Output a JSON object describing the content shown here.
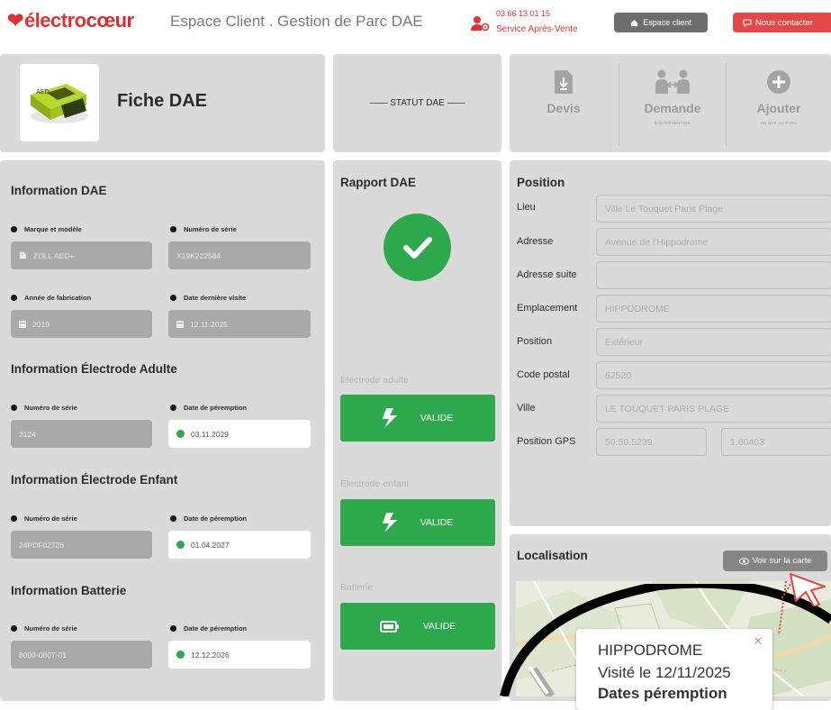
{
  "header": {
    "logo_part1": "électro",
    "logo_part2": "cœur",
    "site_title": "Espace Client . Gestion de Parc DAE",
    "phone_number": "03 66 13 01 15",
    "phone_caption": "Service Après-Vente",
    "espace_client_label": "Espace client",
    "contact_label": "Nous contacter"
  },
  "top": {
    "fiche_title": "Fiche DAE",
    "fiche_image_text": "AED",
    "statut_label": "—— STATUT DAE ——",
    "actions": [
      {
        "label": "Devis",
        "sub": "",
        "icon": "document-download-icon"
      },
      {
        "label": "Demande",
        "sub": "D'INTERVENTION",
        "icon": "technician-icon"
      },
      {
        "label": "Ajouter",
        "sub": "UN DAE AU PARC",
        "icon": "plus-circle-icon"
      }
    ]
  },
  "info_dae": {
    "title": "Information DAE",
    "marque_label": "Marque et modèle",
    "marque_value": "ZOLL AED+",
    "serie_label": "Numéro de série",
    "serie_value": "X19K222584",
    "annee_label": "Année de fabrication",
    "annee_value": "2019",
    "visite_label": "Date dernière visite",
    "visite_value": "12.11.2025"
  },
  "electrode_adulte": {
    "title": "Information Électrode Adulte",
    "serie_label": "Numéro de série",
    "serie_value": "3124",
    "peremption_label": "Date de péremption",
    "peremption_value": "03.11.2029"
  },
  "electrode_enfant": {
    "title": "Information Électrode Enfant",
    "serie_label": "Numéro de série",
    "serie_value": "24PDF02726",
    "peremption_label": "Date de péremption",
    "peremption_value": "01.04.2027"
  },
  "batterie": {
    "title": "Information Batterie",
    "serie_label": "Numéro de série",
    "serie_value": "8000-0807-01",
    "peremption_label": "Date de péremption",
    "peremption_value": "12.12.2026"
  },
  "rapport": {
    "title": "Rapport DAE",
    "items": [
      {
        "label": "Électrode adulte",
        "status": "VALIDE",
        "icon": "bolt-icon"
      },
      {
        "label": "Électrode enfant",
        "status": "VALIDE",
        "icon": "bolt-icon"
      },
      {
        "label": "Batterie",
        "status": "VALIDE",
        "icon": "battery-icon"
      }
    ]
  },
  "position": {
    "title": "Position",
    "fields": [
      {
        "label": "Lieu",
        "value": "Ville Le Touquet Paris Plage"
      },
      {
        "label": "Adresse",
        "value": "Avenue de l'Hippodrome"
      },
      {
        "label": "Adresse suite",
        "value": ""
      },
      {
        "label": "Emplacement",
        "value": "HIPPODROME"
      },
      {
        "label": "Position",
        "value": "Extérieur"
      },
      {
        "label": "Code postal",
        "value": "62520"
      },
      {
        "label": "Ville",
        "value": "LE TOUQUET PARIS PLAGE"
      }
    ],
    "gps_label": "Position GPS",
    "gps_lat": "50.50.5239",
    "gps_lon": "1.60403"
  },
  "localisation": {
    "title": "Localisation",
    "voir_label": "Voir sur la carte",
    "popup_title": "HIPPODROME",
    "popup_visit": "Visité le 12/11/2025",
    "popup_dates": "Dates péremption",
    "popup_close": "×"
  },
  "colors": {
    "brand_red": "#e03232",
    "valid_green": "#2ea84d",
    "panel_grey": "#dadada"
  }
}
